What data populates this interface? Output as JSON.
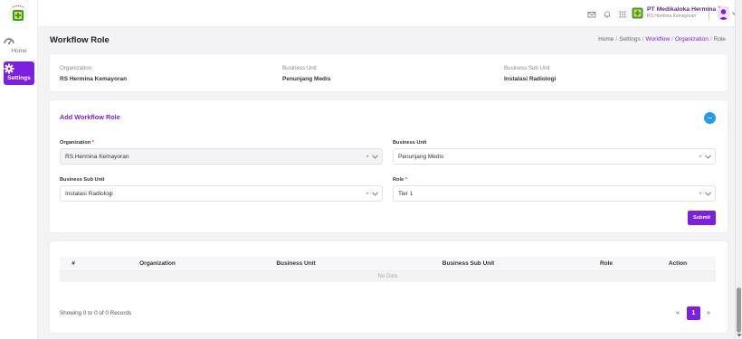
{
  "sidebar": {
    "logo_icon": "hospital-logo",
    "items": [
      {
        "label": "Home",
        "icon": "dashboard-icon"
      },
      {
        "label": "Settings",
        "icon": "gear-icon"
      }
    ]
  },
  "topbar": {
    "icons": [
      "mail-icon",
      "bell-icon",
      "apps-grid-icon"
    ],
    "company_name": "PT Medikaloka Hermina Tbk",
    "company_sub": "RS Hermina Kemayoran"
  },
  "page": {
    "title": "Workflow Role",
    "breadcrumb": [
      "Home",
      "Settings",
      "Workflow",
      "Organization",
      "Role"
    ]
  },
  "info": {
    "organization_label": "Organization",
    "organization_value": "RS Hermina Kemayoran",
    "business_unit_label": "Business Unit",
    "business_unit_value": "Penunjang Medis",
    "business_sub_unit_label": "Business Sub Unit",
    "business_sub_unit_value": "Instalasi Radiologi"
  },
  "form": {
    "title": "Add Workflow Role",
    "collapse_symbol": "–",
    "organization_label": "Organization",
    "organization_value": "RS Hermina Kemayoran",
    "business_unit_label": "Business Unit",
    "business_unit_value": "Penunjang Medis",
    "business_sub_unit_label": "Business Sub Unit",
    "business_sub_unit_value": "Instalasi Radiologi",
    "role_label": "Role",
    "role_value": "Tier 1",
    "required_mark": "*",
    "clear_symbol": "×",
    "submit_label": "Submit"
  },
  "table": {
    "columns": [
      "#",
      "Organization",
      "Business Unit",
      "Business Sub Unit",
      "Role",
      "Action"
    ],
    "empty_text": "No Data",
    "records_text": "Showing 0 to 0 of 0 Records",
    "pager": {
      "prev": "«",
      "current": "1",
      "next": "»"
    }
  },
  "colors": {
    "accent": "#7b1fe0",
    "info_button": "#1e9cf0",
    "required": "#e53935"
  }
}
